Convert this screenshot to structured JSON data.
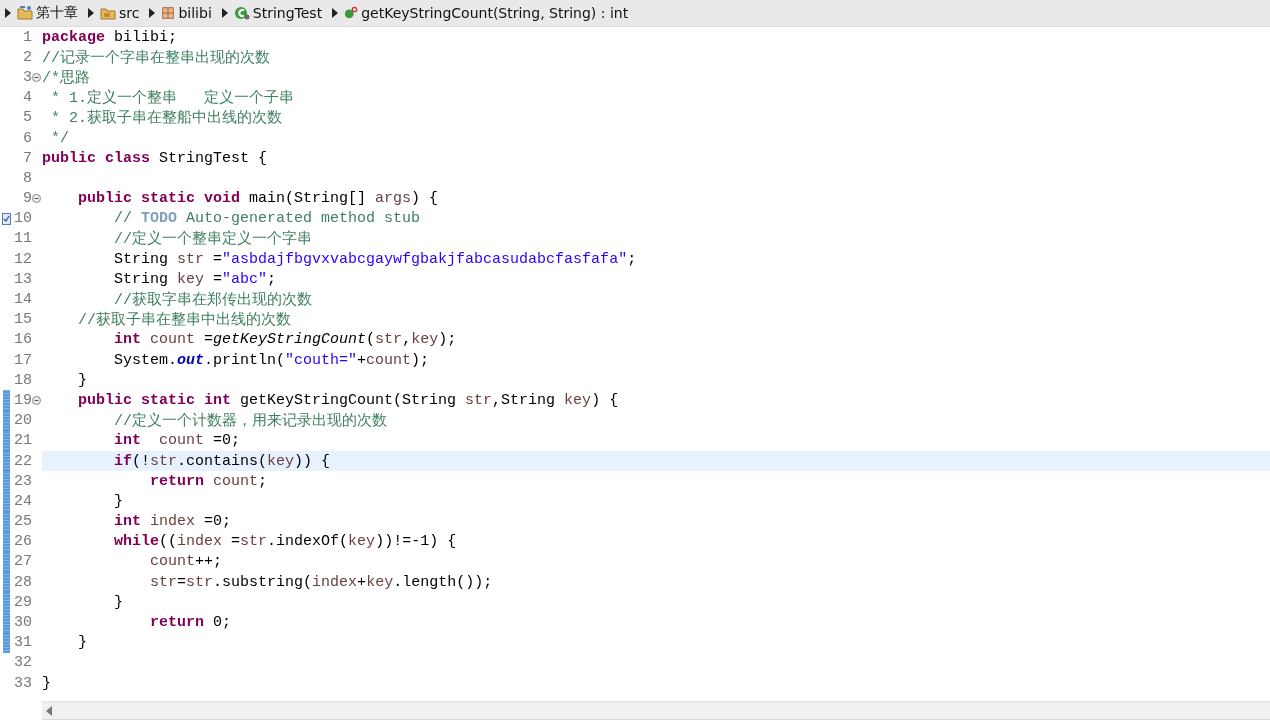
{
  "breadcrumb": [
    {
      "label": "第十章",
      "kind": "project"
    },
    {
      "label": "src",
      "kind": "source-folder"
    },
    {
      "label": "bilibi",
      "kind": "package"
    },
    {
      "label": "StringTest",
      "kind": "class"
    },
    {
      "label": "getKeyStringCount(String, String) : int",
      "kind": "method"
    }
  ],
  "lines": [
    {
      "number": "1",
      "fold": false,
      "changed": false,
      "current": false,
      "task": false,
      "tokens": [
        {
          "kind": "kw",
          "t": "package"
        },
        {
          "kind": "plain",
          "t": " bilibi;"
        }
      ]
    },
    {
      "number": "2",
      "fold": false,
      "changed": false,
      "current": false,
      "task": false,
      "tokens": [
        {
          "kind": "cm",
          "t": "//记录一个字串在整串出现的次数"
        }
      ]
    },
    {
      "number": "3",
      "fold": true,
      "changed": false,
      "current": false,
      "task": false,
      "tokens": [
        {
          "kind": "cm",
          "t": "/*思路"
        }
      ]
    },
    {
      "number": "4",
      "fold": false,
      "changed": false,
      "current": false,
      "task": false,
      "tokens": [
        {
          "kind": "cm",
          "t": " * 1.定义一个整串   定义一个子串"
        }
      ]
    },
    {
      "number": "5",
      "fold": false,
      "changed": false,
      "current": false,
      "task": false,
      "tokens": [
        {
          "kind": "cm",
          "t": " * 2.获取子串在整船中出线的次数"
        }
      ]
    },
    {
      "number": "6",
      "fold": false,
      "changed": false,
      "current": false,
      "task": false,
      "tokens": [
        {
          "kind": "cm",
          "t": " */"
        }
      ]
    },
    {
      "number": "7",
      "fold": false,
      "changed": false,
      "current": false,
      "task": false,
      "tokens": [
        {
          "kind": "kw",
          "t": "public class"
        },
        {
          "kind": "plain",
          "t": " StringTest {"
        }
      ]
    },
    {
      "number": "8",
      "fold": false,
      "changed": false,
      "current": false,
      "task": false
    },
    {
      "number": "9",
      "fold": true,
      "changed": false,
      "current": false,
      "task": false,
      "tokens": [
        {
          "kind": "kw",
          "t": "    public static void"
        },
        {
          "kind": "plain",
          "t": " main(String[] "
        },
        {
          "kind": "var",
          "t": "args"
        },
        {
          "kind": "plain",
          "t": ") {"
        }
      ]
    },
    {
      "number": "10",
      "fold": false,
      "changed": false,
      "current": false,
      "task": true,
      "tokens": [
        {
          "kind": "cm",
          "t": "        // "
        },
        {
          "kind": "tag",
          "t": "TODO"
        },
        {
          "kind": "cm",
          "t": " Auto-generated method stub"
        }
      ]
    },
    {
      "number": "11",
      "fold": false,
      "changed": false,
      "current": false,
      "task": false,
      "tokens": [
        {
          "kind": "cm",
          "t": "        //定义一个整串定义一个字串"
        }
      ]
    },
    {
      "number": "12",
      "fold": false,
      "changed": false,
      "current": false,
      "task": false,
      "tokens": [
        {
          "kind": "plain",
          "t": "        String "
        },
        {
          "kind": "var",
          "t": "str"
        },
        {
          "kind": "plain",
          "t": " ="
        },
        {
          "kind": "str",
          "t": "\"asbdajfbgvxvabcgaywfgbakjfabcasudabcfasfafa\""
        },
        {
          "kind": "plain",
          "t": ";"
        }
      ]
    },
    {
      "number": "13",
      "fold": false,
      "changed": false,
      "current": false,
      "task": false,
      "tokens": [
        {
          "kind": "plain",
          "t": "        String "
        },
        {
          "kind": "var",
          "t": "key"
        },
        {
          "kind": "plain",
          "t": " ="
        },
        {
          "kind": "str",
          "t": "\"abc\""
        },
        {
          "kind": "plain",
          "t": ";"
        }
      ]
    },
    {
      "number": "14",
      "fold": false,
      "changed": false,
      "current": false,
      "task": false,
      "tokens": [
        {
          "kind": "cm",
          "t": "        //获取字串在郑传出现的次数"
        }
      ]
    },
    {
      "number": "15",
      "fold": false,
      "changed": false,
      "current": false,
      "task": false,
      "tokens": [
        {
          "kind": "cm",
          "t": "    //获取子串在整串中出线的次数"
        }
      ]
    },
    {
      "number": "16",
      "fold": false,
      "changed": false,
      "current": false,
      "task": false,
      "tokens": [
        {
          "kind": "kw",
          "t": "        int"
        },
        {
          "kind": "var",
          "t": " count"
        },
        {
          "kind": "plain",
          "t": " ="
        },
        {
          "kind": "call",
          "t": "getKeyStringCount"
        },
        {
          "kind": "plain",
          "t": "("
        },
        {
          "kind": "var",
          "t": "str"
        },
        {
          "kind": "plain",
          "t": ","
        },
        {
          "kind": "var",
          "t": "key"
        },
        {
          "kind": "plain",
          "t": ");"
        }
      ]
    },
    {
      "number": "17",
      "fold": false,
      "changed": false,
      "current": false,
      "task": false,
      "tokens": [
        {
          "kind": "plain",
          "t": "        System."
        },
        {
          "kind": "field",
          "t": "out"
        },
        {
          "kind": "plain",
          "t": ".println("
        },
        {
          "kind": "str",
          "t": "\"couth=\""
        },
        {
          "kind": "plain",
          "t": "+"
        },
        {
          "kind": "var",
          "t": "count"
        },
        {
          "kind": "plain",
          "t": ");"
        }
      ]
    },
    {
      "number": "18",
      "fold": false,
      "changed": false,
      "current": false,
      "task": false,
      "tokens": [
        {
          "kind": "plain",
          "t": "    }"
        }
      ]
    },
    {
      "number": "19",
      "fold": true,
      "changed": true,
      "current": false,
      "task": false,
      "tokens": [
        {
          "kind": "kw",
          "t": "    public static int"
        },
        {
          "kind": "plain",
          "t": " getKeyStringCount(String "
        },
        {
          "kind": "var",
          "t": "str"
        },
        {
          "kind": "plain",
          "t": ",String "
        },
        {
          "kind": "var",
          "t": "key"
        },
        {
          "kind": "plain",
          "t": ") {"
        }
      ]
    },
    {
      "number": "20",
      "fold": false,
      "changed": true,
      "current": false,
      "task": false,
      "tokens": [
        {
          "kind": "cm",
          "t": "        //定义一个计数器，用来记录出现的次数"
        }
      ]
    },
    {
      "number": "21",
      "fold": false,
      "changed": true,
      "current": false,
      "task": false,
      "tokens": [
        {
          "kind": "kw",
          "t": "        int"
        },
        {
          "kind": "var",
          "t": "  count"
        },
        {
          "kind": "plain",
          "t": " =0;"
        }
      ]
    },
    {
      "number": "22",
      "fold": false,
      "changed": true,
      "current": true,
      "task": false,
      "tokens": [
        {
          "kind": "kw",
          "t": "        if"
        },
        {
          "kind": "plain",
          "t": "(!"
        },
        {
          "kind": "var",
          "t": "str"
        },
        {
          "kind": "plain",
          "t": ".contains("
        },
        {
          "kind": "var",
          "t": "key"
        },
        {
          "kind": "plain",
          "t": ")) {"
        }
      ]
    },
    {
      "number": "23",
      "fold": false,
      "changed": true,
      "current": false,
      "task": false,
      "tokens": [
        {
          "kind": "kw",
          "t": "            return"
        },
        {
          "kind": "var",
          "t": " count"
        },
        {
          "kind": "plain",
          "t": ";"
        }
      ]
    },
    {
      "number": "24",
      "fold": false,
      "changed": true,
      "current": false,
      "task": false,
      "tokens": [
        {
          "kind": "plain",
          "t": "        }"
        }
      ]
    },
    {
      "number": "25",
      "fold": false,
      "changed": true,
      "current": false,
      "task": false,
      "tokens": [
        {
          "kind": "kw",
          "t": "        int"
        },
        {
          "kind": "var",
          "t": " index"
        },
        {
          "kind": "plain",
          "t": " =0;"
        }
      ]
    },
    {
      "number": "26",
      "fold": false,
      "changed": true,
      "current": false,
      "task": false,
      "tokens": [
        {
          "kind": "kw",
          "t": "        while"
        },
        {
          "kind": "plain",
          "t": "(("
        },
        {
          "kind": "var",
          "t": "index"
        },
        {
          "kind": "plain",
          "t": " ="
        },
        {
          "kind": "var",
          "t": "str"
        },
        {
          "kind": "plain",
          "t": ".indexOf("
        },
        {
          "kind": "var",
          "t": "key"
        },
        {
          "kind": "plain",
          "t": "))!=-1) {"
        }
      ]
    },
    {
      "number": "27",
      "fold": false,
      "changed": true,
      "current": false,
      "task": false,
      "tokens": [
        {
          "kind": "var",
          "t": "            count"
        },
        {
          "kind": "plain",
          "t": "++;"
        }
      ]
    },
    {
      "number": "28",
      "fold": false,
      "changed": true,
      "current": false,
      "task": false,
      "tokens": [
        {
          "kind": "var",
          "t": "            str"
        },
        {
          "kind": "plain",
          "t": "="
        },
        {
          "kind": "var",
          "t": "str"
        },
        {
          "kind": "plain",
          "t": ".substring("
        },
        {
          "kind": "var",
          "t": "index"
        },
        {
          "kind": "plain",
          "t": "+"
        },
        {
          "kind": "var",
          "t": "key"
        },
        {
          "kind": "plain",
          "t": ".length());"
        }
      ]
    },
    {
      "number": "29",
      "fold": false,
      "changed": true,
      "current": false,
      "task": false,
      "tokens": [
        {
          "kind": "plain",
          "t": "        }"
        }
      ]
    },
    {
      "number": "30",
      "fold": false,
      "changed": true,
      "current": false,
      "task": false,
      "tokens": [
        {
          "kind": "kw",
          "t": "            return"
        },
        {
          "kind": "plain",
          "t": " 0;"
        }
      ]
    },
    {
      "number": "31",
      "fold": false,
      "changed": true,
      "current": false,
      "task": false,
      "tokens": [
        {
          "kind": "plain",
          "t": "    }"
        }
      ]
    },
    {
      "number": "32",
      "fold": false,
      "changed": false,
      "current": false,
      "task": false
    },
    {
      "number": "33",
      "fold": false,
      "changed": false,
      "current": false,
      "task": false,
      "tokens": [
        {
          "kind": "plain",
          "t": "}"
        }
      ]
    }
  ]
}
